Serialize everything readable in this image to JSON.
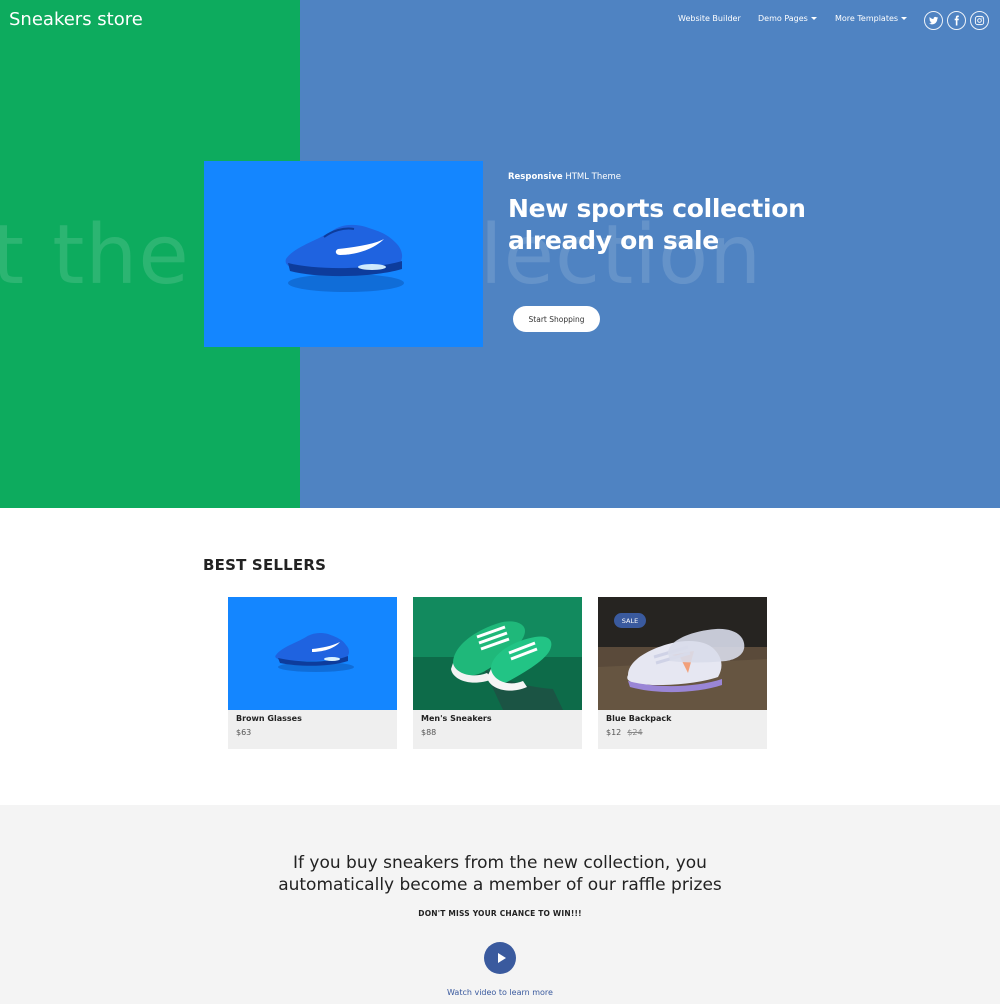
{
  "header": {
    "brand": "Sneakers store",
    "nav": [
      {
        "label": "Website Builder",
        "has_caret": false
      },
      {
        "label": "Demo Pages",
        "has_caret": true
      },
      {
        "label": "More Templates",
        "has_caret": true
      }
    ],
    "social": [
      "twitter-icon",
      "facebook-icon",
      "instagram-icon"
    ]
  },
  "hero": {
    "bg_text_left": "t the",
    "bg_text_right": "llection",
    "eyebrow_bold": "Responsive",
    "eyebrow_rest": " HTML Theme",
    "headline": "New sports collection already on sale",
    "cta": "Start Shopping",
    "colors": {
      "left_panel": "#0dab5e",
      "right_panel": "#4f83c2",
      "photo_bg": "#1486ff"
    }
  },
  "best_sellers": {
    "title": "BEST SELLERS",
    "products": [
      {
        "name": "Brown Glasses",
        "price": "$63",
        "old_price": "",
        "badge": ""
      },
      {
        "name": "Men's Sneakers",
        "price": "$88",
        "old_price": "",
        "badge": ""
      },
      {
        "name": "Blue Backpack",
        "price": "$12",
        "old_price": "$24",
        "badge": "SALE"
      }
    ]
  },
  "raffle": {
    "line1": "If you buy sneakers from the new collection, you",
    "line2": "automatically become a member of our raffle prizes",
    "sub": "DON'T MISS YOUR CHANCE TO WIN!!!",
    "video_label": "Watch video to learn more"
  }
}
